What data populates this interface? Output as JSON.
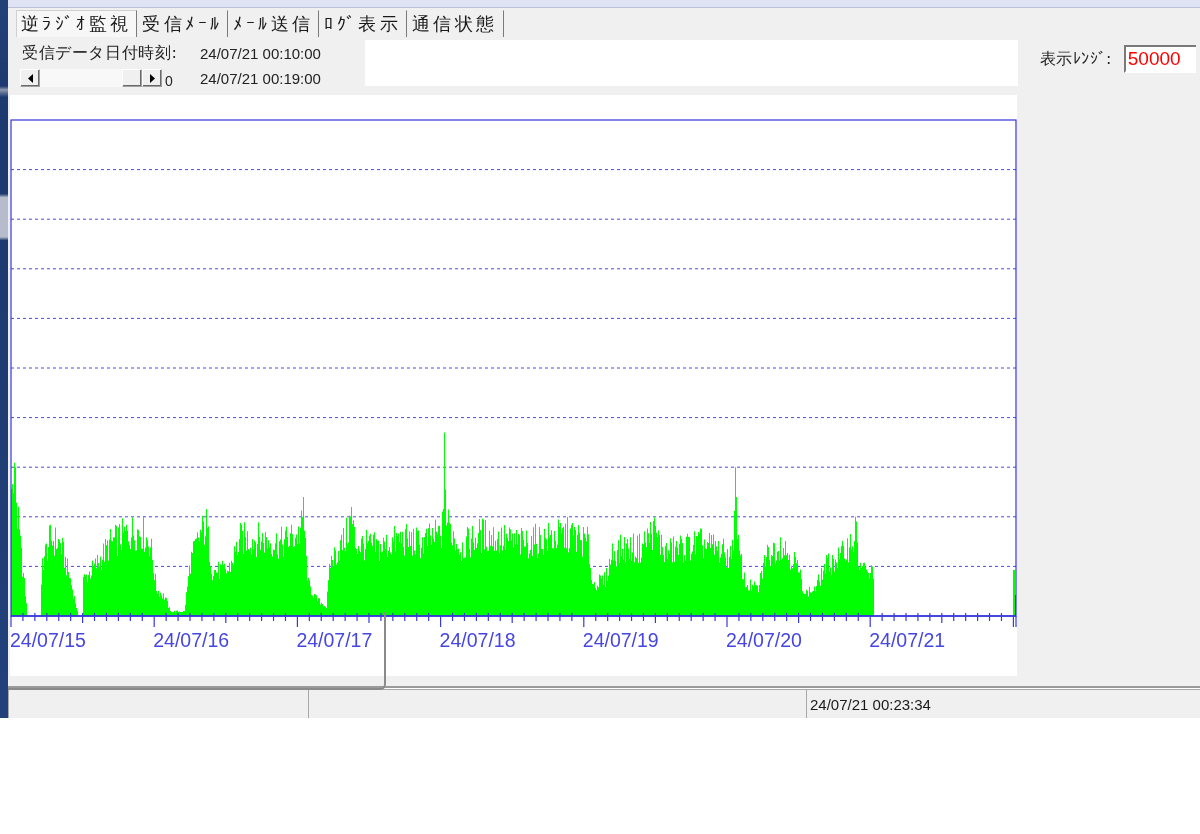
{
  "tabs": [
    {
      "label": "逆ﾗｼﾞｵ監視",
      "selected": true
    },
    {
      "label": "受信ﾒｰﾙ",
      "selected": false
    },
    {
      "label": "ﾒｰﾙ送信",
      "selected": false
    },
    {
      "label": "ﾛｸﾞ表示",
      "selected": false
    },
    {
      "label": "通信状態",
      "selected": false
    }
  ],
  "received": {
    "label": "受信データ日付時刻:",
    "start": "24/07/21 00:10:00",
    "end": "24/07/21 00:19:00",
    "scroll_value": "0"
  },
  "display_range": {
    "label": "表示ﾚﾝｼﾞ:",
    "value": "50000"
  },
  "chart": {
    "x_labels": [
      "24/07/15",
      "24/07/16",
      "24/07/17",
      "24/07/18",
      "24/07/19",
      "24/07/20",
      "24/07/21"
    ]
  },
  "status_bar": {
    "time": "24/07/21 00:23:34"
  }
}
